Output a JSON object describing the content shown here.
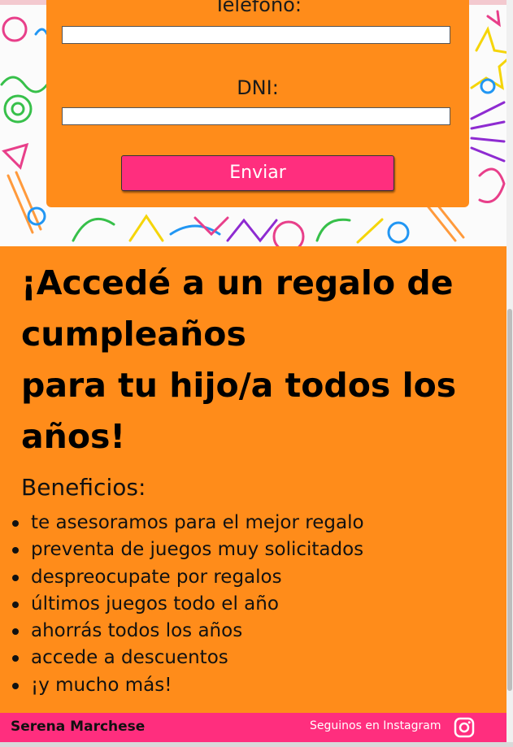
{
  "form": {
    "phone_label": "Teléfono:",
    "phone_value": "",
    "dni_label": "DNI:",
    "dni_value": "",
    "submit_label": "Enviar"
  },
  "promo": {
    "headline_line1": "¡Accedé a un regalo de",
    "headline_line2": "cumpleaños",
    "headline_line3": "para tu hijo/a todos los",
    "headline_line4": "años!",
    "benefits_title": "Beneficios:",
    "benefits": [
      "te asesoramos para el mejor regalo",
      "preventa de juegos muy solicitados",
      "despreocupate por regalos",
      "últimos juegos todo el año",
      "ahorrás todos los años",
      "accede a descuentos",
      "¡y mucho más!"
    ]
  },
  "footer": {
    "name": "Serena Marchese",
    "follow_text": "Seguinos en Instagram"
  },
  "colors": {
    "orange": "#ff8c1a",
    "pink": "#ff2e7e"
  },
  "icons": [
    "doodle-background",
    "instagram-icon"
  ]
}
